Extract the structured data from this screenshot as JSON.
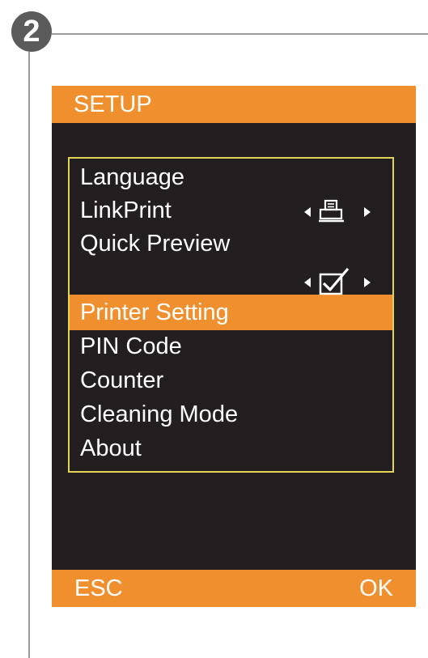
{
  "step": {
    "number": "2"
  },
  "screen": {
    "title": "SETUP",
    "menu": {
      "language": "Language",
      "linkprint": "LinkPrint",
      "quick_preview": "Quick Preview",
      "printer_setting": "Printer Setting",
      "pin_code": "PIN Code",
      "counter": "Counter",
      "cleaning_mode": "Cleaning Mode",
      "about": "About"
    },
    "linkprint_icon": "printer-icon",
    "quick_preview_state": "checked",
    "selected_item": "Printer Setting",
    "footer": {
      "esc": "ESC",
      "ok": "OK"
    }
  },
  "colors": {
    "accent": "#f08f2e",
    "screen_background": "#231f20",
    "menu_frame": "#e3d455",
    "text": "#ffffff"
  }
}
